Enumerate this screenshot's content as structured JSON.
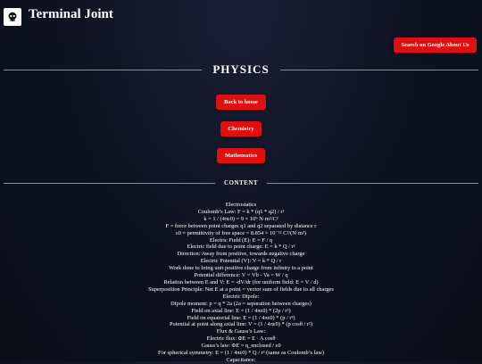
{
  "header": {
    "site_title": "Terminal Joint",
    "logo_icon": "skull-logo-icon"
  },
  "search_button": {
    "label": "Search on Google About Us"
  },
  "page_heading": "PHYSICS",
  "nav": [
    {
      "label": "Back to home"
    },
    {
      "label": "Chemistry"
    },
    {
      "label": "Mathematics"
    }
  ],
  "content_heading": "CONTENT",
  "content_lines": [
    "Electrostatics",
    "Coulomb’s Law: F = k * (q1 * q2) / r²",
    "k = 1 / (4πε0) = 9 × 10⁹ N·m²/C²",
    "F = force between point charges q1 and q2 separated by distance r",
    "ε0 = permittivity of free space = 8.854 × 10⁻¹² C²/(N·m²)",
    "Electric Field (E): E = F / q",
    "Electric field due to point charge: E = k * Q / r²",
    "Direction: Away from positive, towards negative charge",
    "Electric Potential (V): V = k * Q / r",
    "Work done to bring unit positive charge from infinity to a point",
    "Potential difference: V = Vb - Va = W / q",
    "Relation between E and V: E = -dV/dr (for uniform field: E = V / d)",
    "Superposition Principle: Net E at a point = vector sum of fields due to all charges",
    "Electric Dipole:",
    "Dipole moment: p = q * 2a (2a = separation between charges)",
    "Field on axial line: E = (1 / 4πε0) * (2p / r³)",
    "Field on equatorial line: E = (1 / 4πε0) * (p / r³)",
    "Potential at point along axial line: V = (1 / 4πε0) * (p cosθ / r²)",
    "Flux & Gauss’s Law:",
    "Electric flux: ΦE = E · A cosθ",
    "Gauss’s law: ΦE = q_enclosed / ε0",
    "For spherical symmetry: E = (1 / 4πε0) * Q / r² (same as Coulomb’s law)",
    "Capacitance:"
  ],
  "colors": {
    "button_red": "#e01010",
    "background": "#0d1120",
    "text": "#ffffff"
  }
}
